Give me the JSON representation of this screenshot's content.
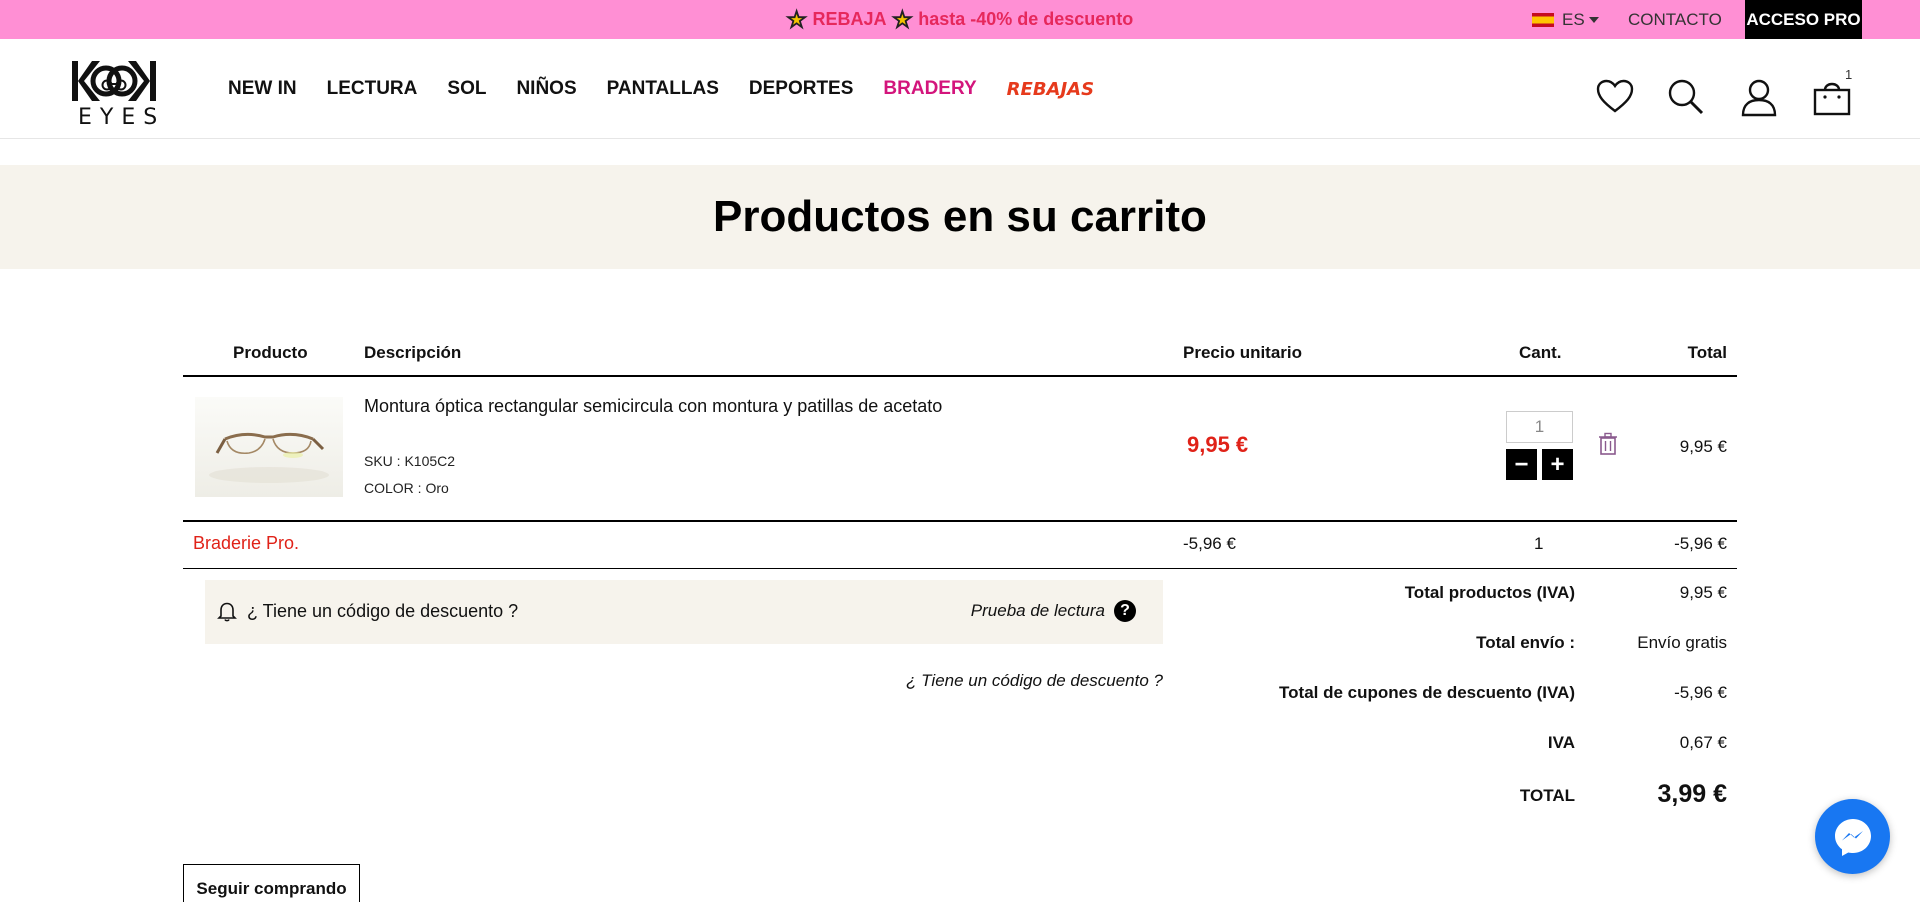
{
  "topbar": {
    "promo_tag": "REBAJA",
    "promo_text": "hasta -40% de descuento",
    "language": "ES",
    "contact": "CONTACTO",
    "pro_access": "ACCESO PRO"
  },
  "header": {
    "logo_text": "EYES",
    "nav": [
      "NEW IN",
      "LECTURA",
      "SOL",
      "NIÑOS",
      "PANTALLAS",
      "DEPORTES",
      "BRADERY",
      "REBAJAS"
    ],
    "cart_count": "1"
  },
  "page_title": "Productos en su carrito",
  "table": {
    "headers": {
      "product": "Producto",
      "description": "Descripción",
      "unit_price": "Precio unitario",
      "qty": "Cant.",
      "total": "Total"
    },
    "items": [
      {
        "description": "Montura óptica rectangular semicircula con montura y patillas de acetato",
        "sku": "SKU : K105C2",
        "color": "COLOR : Oro",
        "unit_price": "9,95 €",
        "qty": "1",
        "total": "9,95 €"
      }
    ],
    "discount_row": {
      "label": "Braderie Pro.",
      "unit_price": "-5,96 €",
      "qty": "1",
      "total": "-5,96 €"
    }
  },
  "coupon": {
    "question": "¿ Tiene un código de descuento ?",
    "reading_test": "Prueba de lectura",
    "help": "?",
    "link": "¿ Tiene un código de descuento ?"
  },
  "summary": {
    "products_label": "Total productos (IVA)",
    "products_value": "9,95 €",
    "shipping_label": "Total envío :",
    "shipping_value": "Envío gratis",
    "coupons_label": "Total de cupones de descuento (IVA)",
    "coupons_value": "-5,96 €",
    "vat_label": "IVA",
    "vat_value": "0,67 €",
    "total_label": "TOTAL",
    "total_value": "3,99 €"
  },
  "continue_button": "Seguir comprando",
  "colors": {
    "promo_bar": "#ff8fd4",
    "promo_text": "#e6285c",
    "price_red": "#e02218",
    "bradery": "#d3157c",
    "banner_bg": "#f6f3ec",
    "messenger": "#1877f2"
  }
}
